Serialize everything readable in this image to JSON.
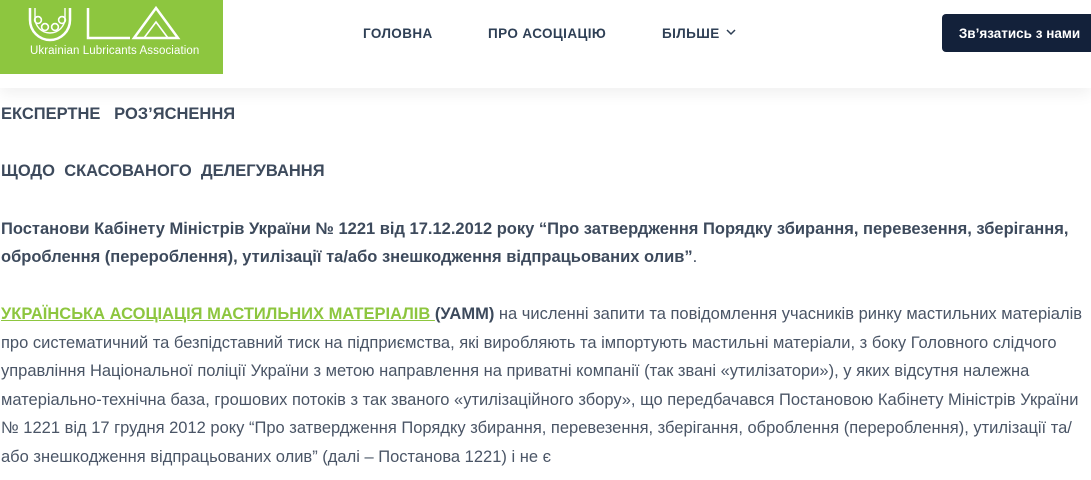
{
  "header": {
    "logo": {
      "mark_text": "ULA",
      "tagline": "Ukrainian Lubricants Association",
      "bg_color": "#8dc63f"
    },
    "nav": {
      "home": "ГОЛОВНА",
      "about": "ПРО АСОЦІАЦІЮ",
      "more": "БІЛЬШЕ"
    },
    "cta_label": "Зв’язатись з нами",
    "cta_color": "#13213a"
  },
  "article": {
    "heading1": "ЕКСПЕРТНЕ   РОЗ’ЯСНЕННЯ",
    "heading2": "ЩОДО  СКАСОВАНОГО  ДЕЛЕГУВАННЯ",
    "decree_bold": "Постанови Кабінету Міністрів України № 1221 від 17.12.2012 року “Про затвердження Порядку збирання, перевезення, зберігання, оброблення (перероблення), утилізації та/або знешкодження відпрацьованих олив”",
    "decree_tail": ".",
    "org_link": "УКРАЇНСЬКА АСОЦІАЦІЯ МАСТИЛЬНИХ МАТЕРІАЛІВ ",
    "org_abbr": "(УАММ)",
    "body_text": " на численні запити та повідомлення учасників ринку мастильних матеріалів про систематичний та безпідставний тиск на підприємства, які виробляють  та імпортують мастильні матеріали, з боку Головного слідчого управління Національної поліції України з метою направлення на приватні компанії (так звані «утилізатори»), у яких відсутня належна матеріально-технічна база, грошових потоків з так званого «утилізаційного збору», що передбачався Постановою Кабінету Міністрів України № 1221 від 17 грудня 2012 року “Про затвердження Порядку збирання, перевезення, зберігання, оброблення (перероблення), утилізації та/або знешкодження відпрацьованих олив” (далі – Постанова 1221) і не є",
    "link_color": "#8dc63f"
  }
}
